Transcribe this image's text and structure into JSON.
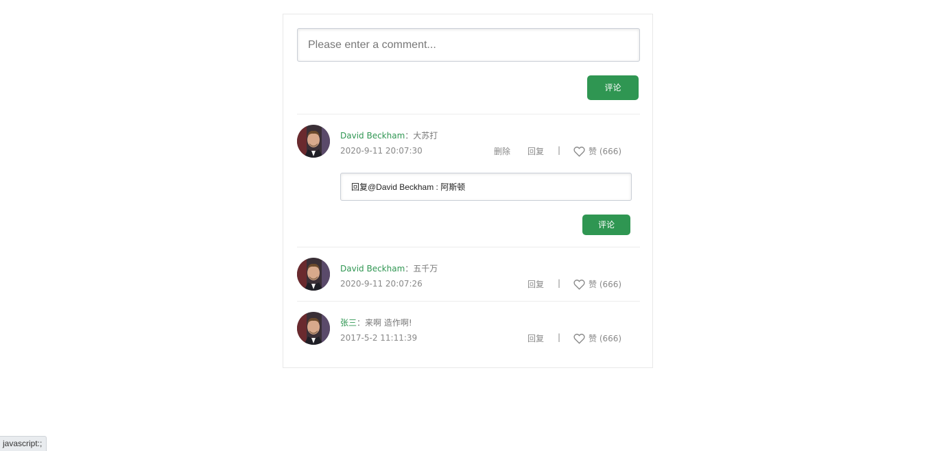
{
  "main": {
    "comment_placeholder": "Please enter a comment...",
    "submit_label": "评论"
  },
  "comments": [
    {
      "author": "David Beckham",
      "separator": "：",
      "text": "大苏打",
      "date": "2020-9-11 20:07:30",
      "delete_label": "删除",
      "reply_label": "回复",
      "divider": "|",
      "like_label": "赞 (666)",
      "reply_box": {
        "value": "回复@David Beckham : 阿斯顿",
        "submit_label": "评论"
      }
    },
    {
      "author": "David Beckham",
      "separator": "：",
      "text": "五千万",
      "date": "2020-9-11 20:07:26",
      "reply_label": "回复",
      "divider": "|",
      "like_label": "赞 (666)"
    },
    {
      "author": "张三",
      "separator": "：",
      "text": "来啊 造作啊!",
      "date": "2017-5-2 11:11:39",
      "reply_label": "回复",
      "divider": "|",
      "like_label": "赞 (666)"
    }
  ],
  "status_bar": {
    "text": "javascript:;"
  },
  "colors": {
    "accent": "#2f9652",
    "muted_text": "#888888",
    "border": "#e8e8e8"
  },
  "icons": {
    "like": "heart-icon",
    "avatar": "user-avatar"
  }
}
